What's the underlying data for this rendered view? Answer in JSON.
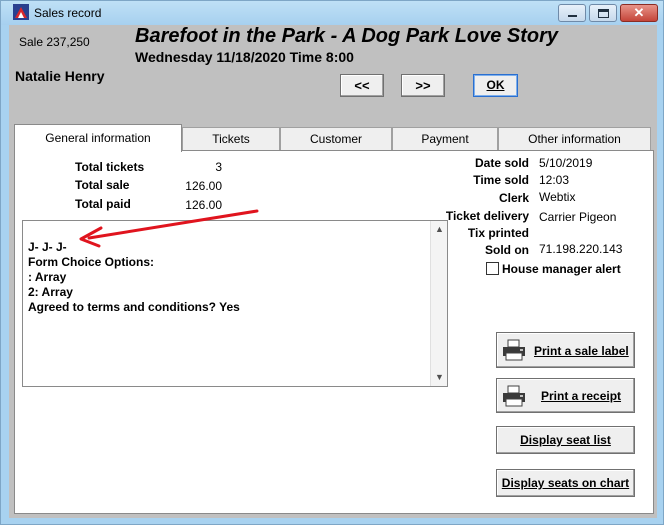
{
  "window": {
    "title": "Sales record"
  },
  "header": {
    "sale_number": "Sale 237,250",
    "show_title": "Barefoot in the Park - A Dog Park Love Story",
    "show_datetime": "Wednesday 11/18/2020  Time 8:00",
    "customer_name": "Natalie Henry",
    "prev_label": "<<",
    "next_label": ">>",
    "ok_label": "OK"
  },
  "tabs": [
    {
      "label": "General information",
      "active": true
    },
    {
      "label": "Tickets",
      "active": false
    },
    {
      "label": "Customer",
      "active": false
    },
    {
      "label": "Payment",
      "active": false
    },
    {
      "label": "Other information",
      "active": false
    }
  ],
  "totals": {
    "tickets_label": "Total tickets",
    "tickets_value": "3",
    "sale_label": "Total sale",
    "sale_value": "126.00",
    "paid_label": "Total paid",
    "paid_value": "126.00"
  },
  "details": {
    "date_sold_label": "Date sold",
    "date_sold_value": "5/10/2019",
    "time_sold_label": "Time sold",
    "time_sold_value": "12:03",
    "clerk_label": "Clerk",
    "clerk_value": "Webtix",
    "delivery_label": "Ticket delivery",
    "delivery_value": "Carrier Pigeon",
    "printed_label": "Tix printed",
    "sold_on_label": "Sold on",
    "sold_on_value": "71.198.220.143",
    "house_alert_label": "House manager alert"
  },
  "notes": {
    "lines": [
      "J- J- J-",
      "Form Choice Options:",
      ": Array",
      "2: Array",
      "Agreed to terms and conditions? Yes"
    ]
  },
  "actions": {
    "print_label": "Print a sale label",
    "print_receipt": "Print a receipt",
    "display_seat_list": "Display seat list",
    "display_seats_chart": "Display seats on chart"
  },
  "annotation": {
    "arrow_color": "#e0141e"
  }
}
